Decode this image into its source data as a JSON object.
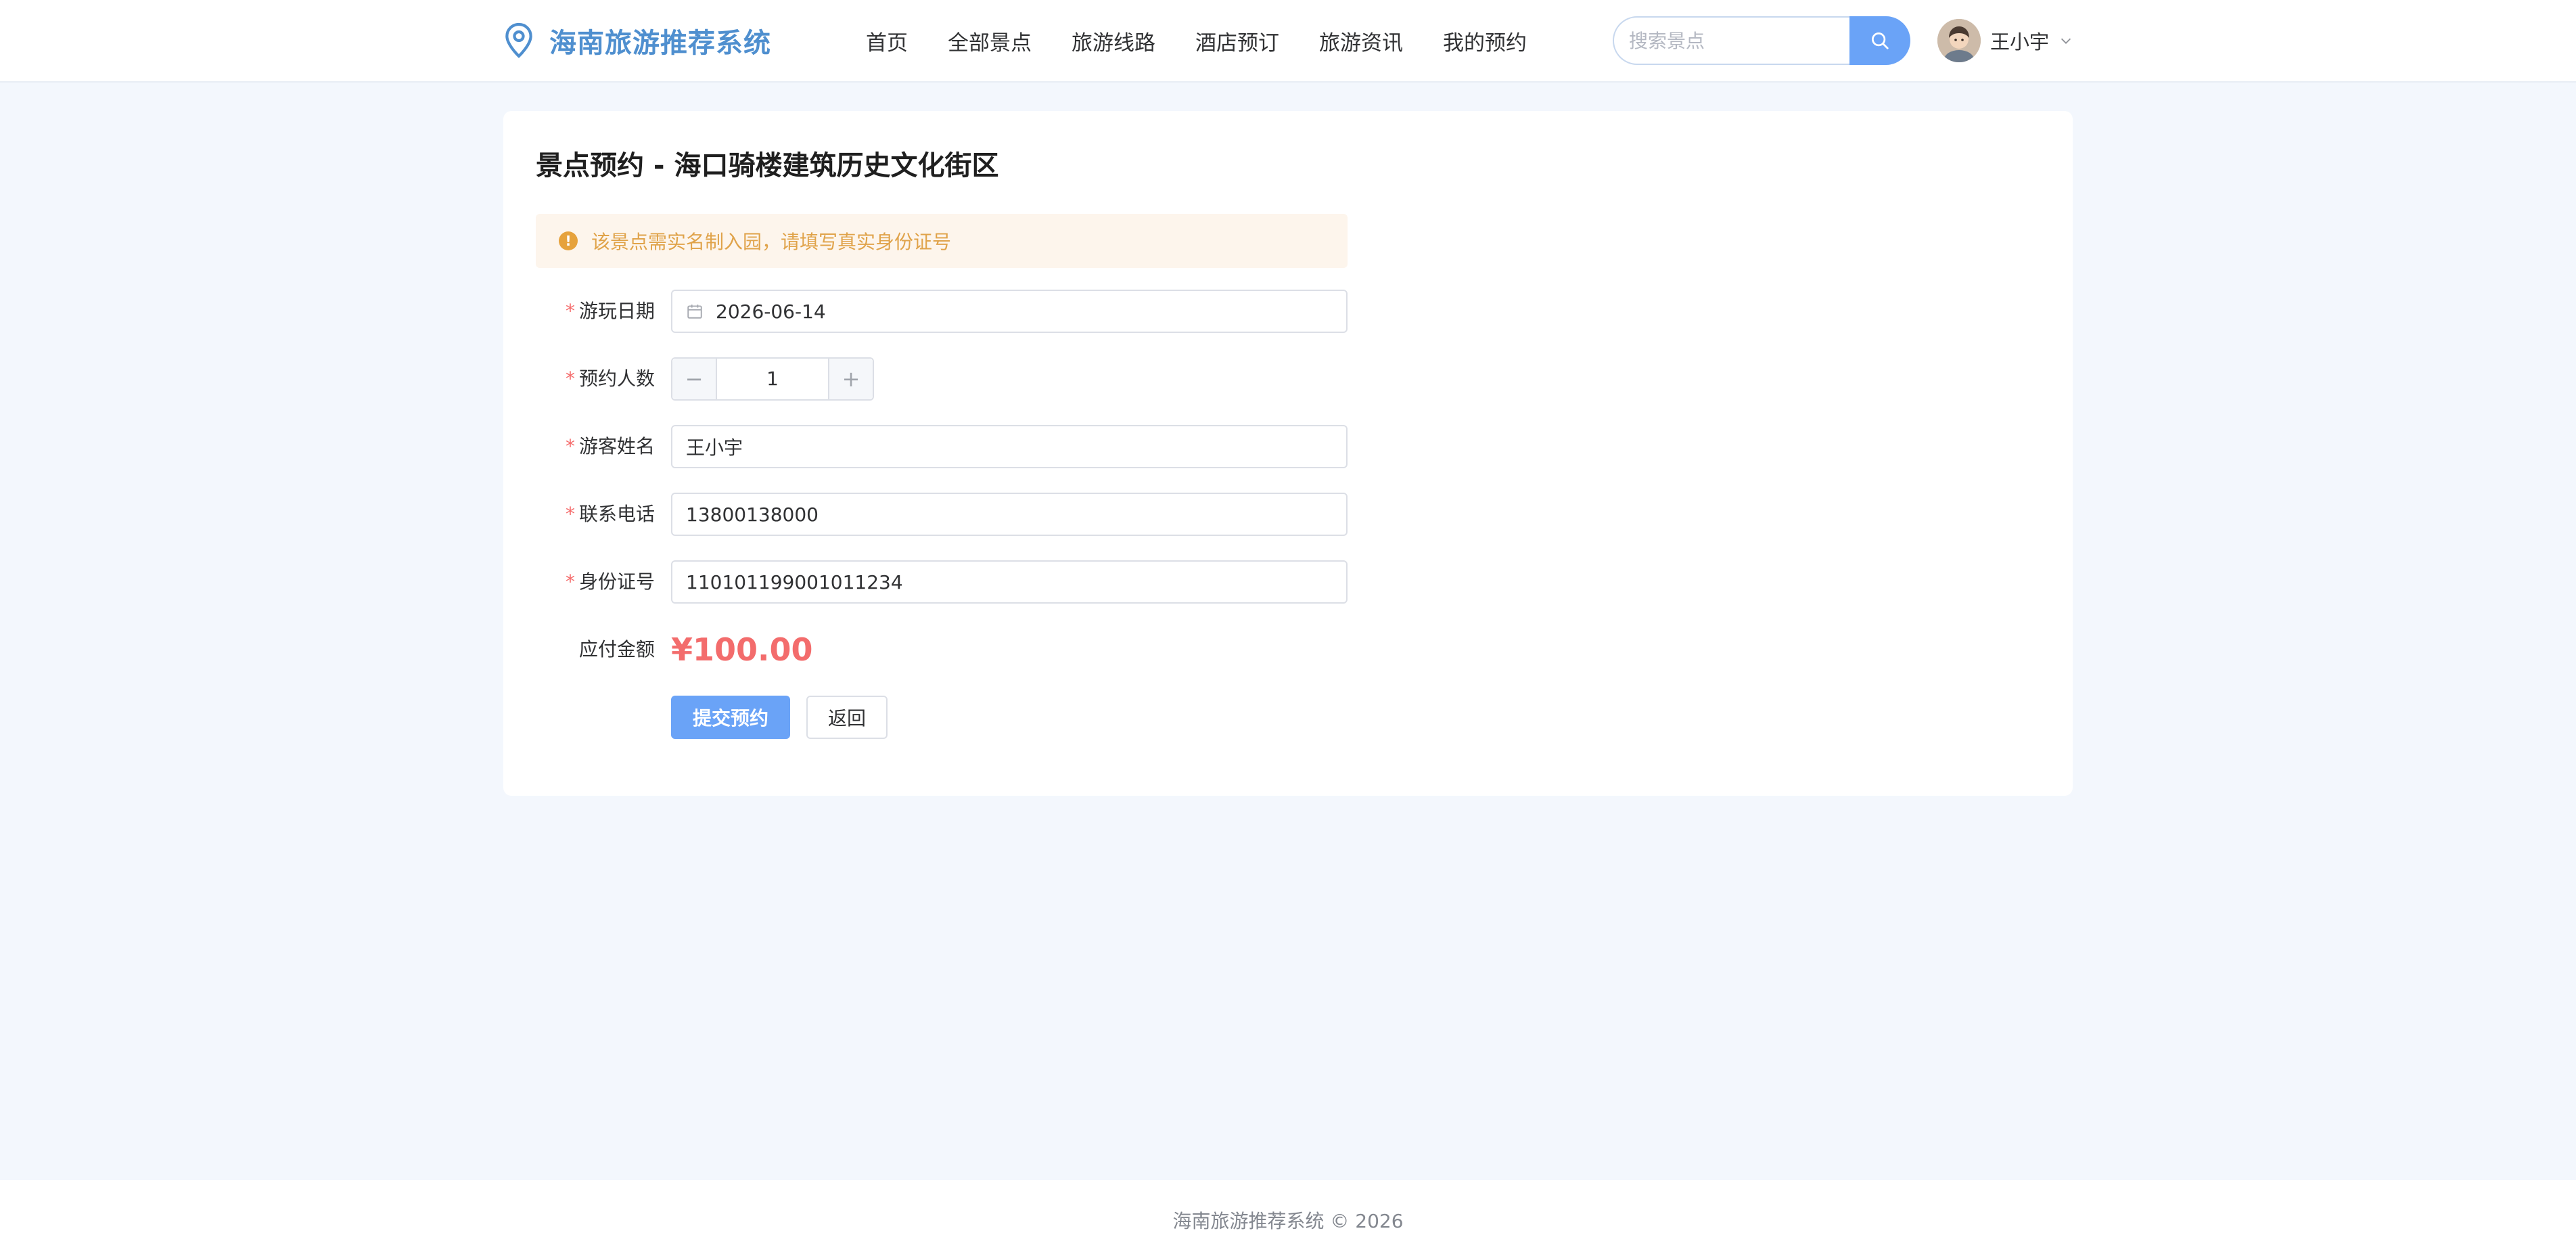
{
  "header": {
    "logo_text": "海南旅游推荐系统",
    "nav": [
      "首页",
      "全部景点",
      "旅游线路",
      "酒店预订",
      "旅游资讯",
      "我的预约"
    ],
    "search_placeholder": "搜索景点",
    "user_name": "王小宇"
  },
  "page": {
    "title": "景点预约 - 海口骑楼建筑历史文化街区",
    "alert": "该景点需实名制入园，请填写真实身份证号"
  },
  "form": {
    "required_mark": "*",
    "date_label": "游玩日期",
    "date_value": "2026-06-14",
    "count_label": "预约人数",
    "count_value": "1",
    "count_minus": "−",
    "count_plus": "+",
    "name_label": "游客姓名",
    "name_value": "王小宇",
    "phone_label": "联系电话",
    "phone_value": "13800138000",
    "id_label": "身份证号",
    "id_value": "110101199001011234",
    "amount_label": "应付金额",
    "amount_value": "¥100.00",
    "submit_label": "提交预约",
    "back_label": "返回"
  },
  "footer": {
    "text": "海南旅游推荐系统 © 2026"
  },
  "colors": {
    "primary": "#6aa3f7",
    "logo": "#4f8fcf",
    "price": "#f36c6c",
    "warning": "#e6a23c",
    "background": "#f3f7fd"
  },
  "icons": {
    "logo": "location-pin-icon",
    "search": "search-icon",
    "date": "calendar-icon",
    "user_menu": "chevron-down-icon",
    "alert": "warning-circle-icon"
  }
}
